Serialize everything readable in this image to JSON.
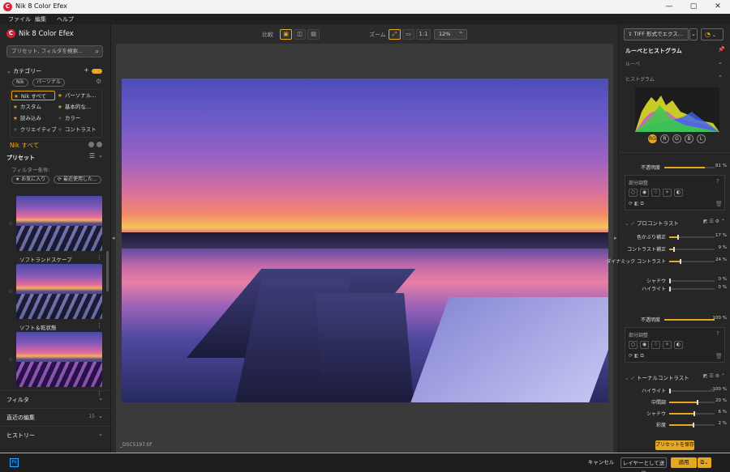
{
  "window": {
    "title": "Nik 8 Color Efex",
    "logo": "C",
    "controls": [
      "—",
      "▢",
      "✕"
    ]
  },
  "menu": [
    "ファイル",
    "編集",
    "ヘルプ"
  ],
  "left": {
    "brand": "Nik 8 Color Efex",
    "search_placeholder": "プリセット, フィルタを検索...",
    "category_header": "カテゴリー",
    "filter_pills": [
      "Nik",
      "パーソナル"
    ],
    "categories": [
      {
        "label": "Nik すべて",
        "star": true
      },
      {
        "label": "パーソナル...",
        "star": true
      },
      {
        "label": "カスタム",
        "star": true
      },
      {
        "label": "基本的な...",
        "star": true
      },
      {
        "label": "読み込み",
        "star": true
      },
      {
        "label": "カラー",
        "star": false
      },
      {
        "label": "クリエイティブ",
        "star": false
      },
      {
        "label": "コントラスト",
        "star": false
      }
    ],
    "current": "Nik すべて",
    "preset_header": "プリセット",
    "filter_cond": "フィルター条件:",
    "cond_pills": [
      "お気に入り",
      "最近使用した..."
    ],
    "presets": [
      "ソフトランドスケープ",
      "ソフト＆乾状態",
      ""
    ],
    "folds": [
      {
        "label": "フィルタ",
        "count": ""
      },
      {
        "label": "直近の編集",
        "count": "15"
      },
      {
        "label": "ヒストリー",
        "count": ""
      }
    ]
  },
  "toolbar": {
    "compare_label": "比較",
    "zoom_label": "ズーム",
    "one_to_one": "1:1",
    "zoom_value": "12%"
  },
  "file_name": "_DSC5197.tif",
  "right": {
    "export_label": "TIFF 形式でエクス...",
    "panel_title": "ルーペとヒストグラム",
    "loupe": "ルーペ",
    "histogram": "ヒストグラム",
    "channels": [
      "RGB",
      "R",
      "G",
      "B",
      "L"
    ],
    "opacity_label": "不透明度",
    "opacity1": "81 %",
    "opacity1_value": 81,
    "partial": "部分調整",
    "filter1_name": "プロコントラスト",
    "filter1_sliders": [
      {
        "label": "色かぶり補正",
        "value": "17 %",
        "pos": 17
      },
      {
        "label": "コントラスト補正",
        "value": "9 %",
        "pos": 9
      },
      {
        "label": "ダイナミック コントラスト",
        "value": "24 %",
        "pos": 24
      },
      {
        "label": "シャドウ",
        "value": "0 %",
        "pos": 0
      },
      {
        "label": "ハイライト",
        "value": "0 %",
        "pos": 0
      }
    ],
    "opacity2": "100 %",
    "opacity2_value": 100,
    "filter2_name": "トーナルコントラスト",
    "filter2_sliders": [
      {
        "label": "ハイライト",
        "value": "-100 %",
        "pos": 0
      },
      {
        "label": "中間調",
        "value": "20 %",
        "pos": 60
      },
      {
        "label": "シャドウ",
        "value": "6 %",
        "pos": 53
      },
      {
        "label": "彩度",
        "value": "2 %",
        "pos": 51
      }
    ],
    "save_preset": "プリセットを保存"
  },
  "bottom": {
    "ps": "Ps",
    "cancel": "キャンセル",
    "as_layer": "レイヤーとして送信",
    "apply": "適用"
  },
  "colors": {
    "accent": "#e7a71e",
    "brand": "#d0263a"
  }
}
